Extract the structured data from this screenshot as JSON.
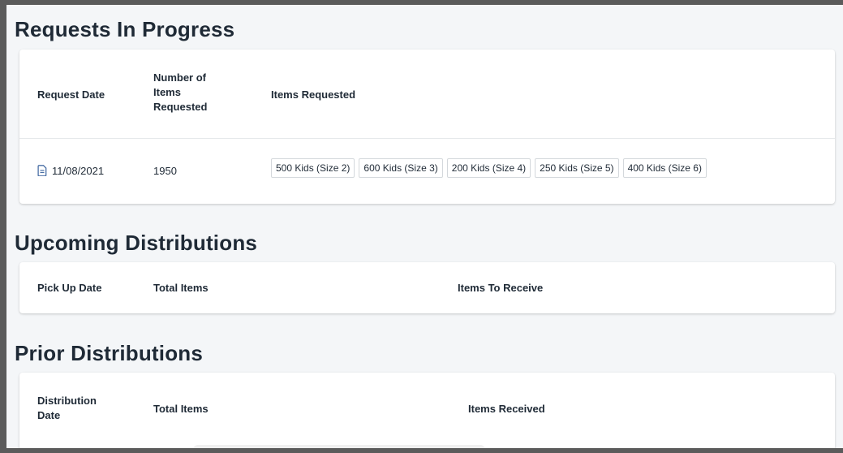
{
  "requests_in_progress": {
    "title": "Requests In Progress",
    "columns": {
      "request_date": "Request Date",
      "number_line1": "Number of",
      "number_line2": "Items",
      "number_line3": "Requested",
      "items_requested": "Items Requested"
    },
    "rows": [
      {
        "date": "11/08/2021",
        "icon": "document-icon",
        "count": "1950",
        "items": [
          "500 Kids (Size 2)",
          "600 Kids (Size 3)",
          "200 Kids (Size 4)",
          "250 Kids (Size 5)",
          "400 Kids (Size 6)"
        ]
      }
    ]
  },
  "upcoming_distributions": {
    "title": "Upcoming Distributions",
    "columns": {
      "pick_up_date": "Pick Up Date",
      "total_items": "Total Items",
      "items_to_receive": "Items To Receive"
    }
  },
  "prior_distributions": {
    "title": "Prior Distributions",
    "columns": {
      "date_line1": "Distribution",
      "date_line2": "Date",
      "total_items": "Total Items",
      "items_received": "Items Received"
    }
  },
  "colors": {
    "page_background": "#f4f6f8",
    "text": "#1f2a36",
    "icon": "#4a6fa5",
    "chip_border": "#d4d8dc"
  }
}
